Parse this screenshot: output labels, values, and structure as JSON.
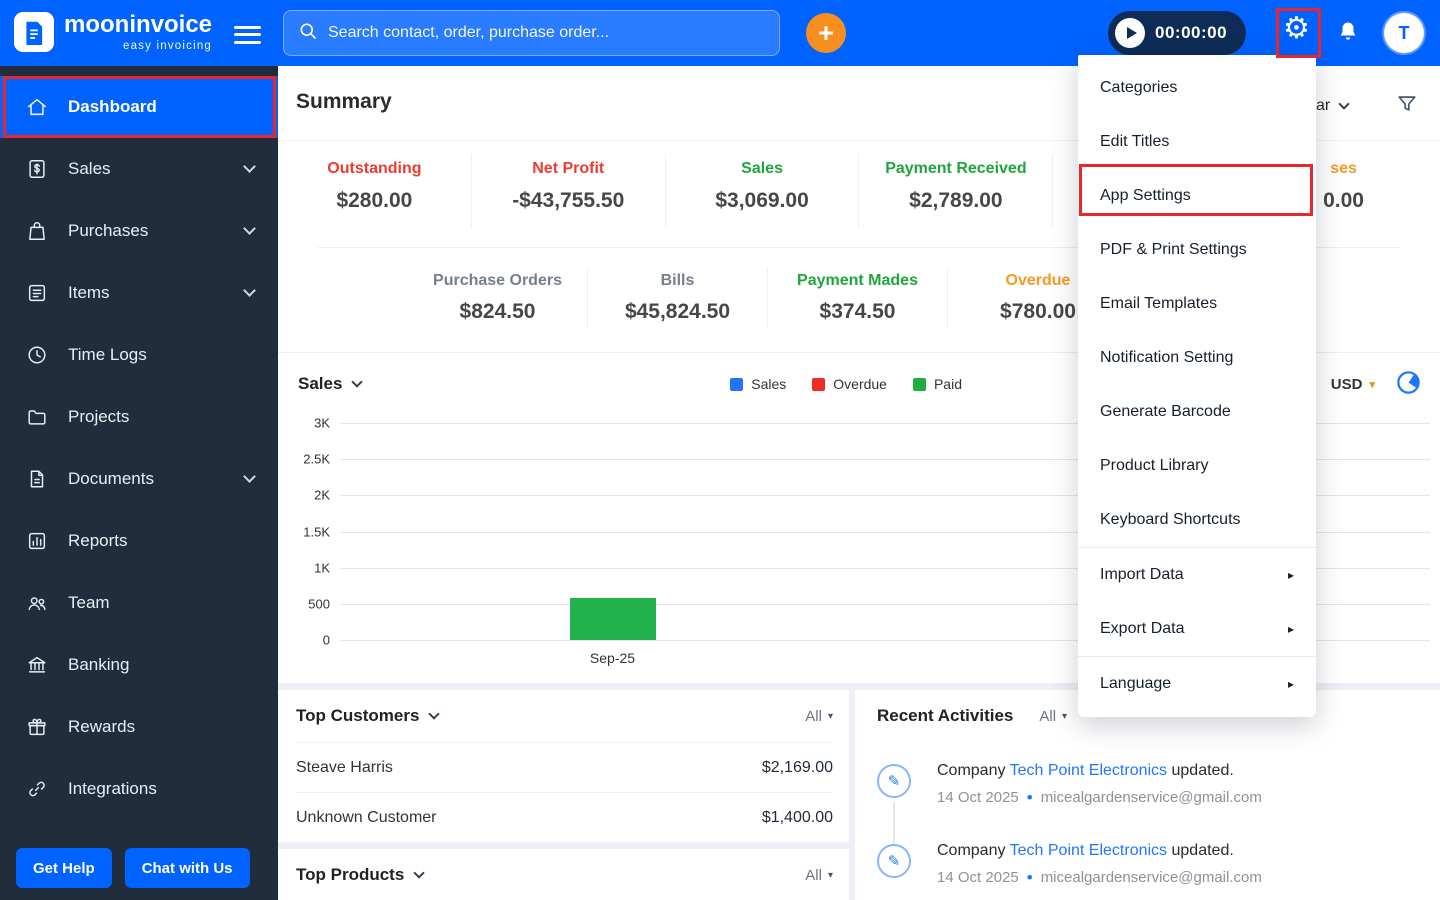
{
  "colors": {
    "topbar_blue": "#0062ff",
    "sidebar_navy": "#1f2d3d",
    "annotation_red": "#e8262b",
    "stat_red": "#ef3b2f",
    "stat_green": "#1ea63c",
    "stat_orange": "#f59a23",
    "link_blue": "#2176ff",
    "bar_green": "#21b24b",
    "plus_orange": "#f78f1e"
  },
  "topbar": {
    "brand": "mooninvoice",
    "tagline": "easy invoicing",
    "search_placeholder": "Search contact, order, purchase order...",
    "timer": "00:00:00",
    "avatar_initial": "T"
  },
  "sidebar": {
    "items": [
      {
        "label": "Dashboard"
      },
      {
        "label": "Sales"
      },
      {
        "label": "Purchases"
      },
      {
        "label": "Items"
      },
      {
        "label": "Time Logs"
      },
      {
        "label": "Projects"
      },
      {
        "label": "Documents"
      },
      {
        "label": "Reports"
      },
      {
        "label": "Team"
      },
      {
        "label": "Banking"
      },
      {
        "label": "Rewards"
      },
      {
        "label": "Integrations"
      }
    ],
    "get_help": "Get Help",
    "chat_with_us": "Chat with Us"
  },
  "summary": {
    "title": "Summary",
    "year_fragment": "ar",
    "row1": [
      {
        "label": "Outstanding",
        "value": "$280.00"
      },
      {
        "label": "Net Profit",
        "value": "-$43,755.50"
      },
      {
        "label": "Sales",
        "value": "$3,069.00"
      },
      {
        "label": "Payment Received",
        "value": "$2,789.00"
      },
      {
        "label": "",
        "value": ""
      },
      {
        "label": "ses",
        "value": "0.00"
      }
    ],
    "row2": [
      {
        "label": "Purchase Orders",
        "value": "$824.50"
      },
      {
        "label": "Bills",
        "value": "$45,824.50"
      },
      {
        "label": "Payment Mades",
        "value": "$374.50"
      },
      {
        "label": "Overdue",
        "value": "$780.00"
      }
    ]
  },
  "chart_data": {
    "type": "bar",
    "title": "Sales",
    "legend": [
      "Sales",
      "Overdue",
      "Paid"
    ],
    "currency": "USD",
    "yticks": [
      "3K",
      "2.5K",
      "2K",
      "1.5K",
      "1K",
      "500",
      "0"
    ],
    "ylim": [
      0,
      3000
    ],
    "categories": [
      "Sep-25"
    ],
    "series": [
      {
        "name": "Paid",
        "values": [
          580
        ]
      }
    ],
    "grid": true,
    "legend_position": "top-center"
  },
  "top_customers": {
    "title": "Top Customers",
    "filter": "All",
    "rows": [
      {
        "name": "Steave Harris",
        "value": "$2,169.00"
      },
      {
        "name": "Unknown Customer",
        "value": "$1,400.00"
      }
    ]
  },
  "top_products": {
    "title": "Top Products",
    "filter": "All"
  },
  "recent_activities": {
    "title": "Recent Activities",
    "filter": "All",
    "entries": [
      {
        "prefix": "Company",
        "link": "Tech Point Electronics",
        "suffix": "updated.",
        "date": "14 Oct 2025",
        "email": "micealgardenservice@gmail.com"
      },
      {
        "prefix": "Company",
        "link": "Tech Point Electronics",
        "suffix": "updated.",
        "date": "14 Oct 2025",
        "email": "micealgardenservice@gmail.com"
      }
    ]
  },
  "settings_menu": {
    "items": [
      {
        "label": "Categories"
      },
      {
        "label": "Edit Titles"
      },
      {
        "label": "App Settings"
      },
      {
        "label": "PDF & Print Settings"
      },
      {
        "label": "Email Templates"
      },
      {
        "label": "Notification Setting"
      },
      {
        "label": "Generate Barcode"
      },
      {
        "label": "Product Library"
      },
      {
        "label": "Keyboard Shortcuts"
      },
      {
        "label": "Import Data",
        "submenu": true
      },
      {
        "label": "Export Data",
        "submenu": true
      },
      {
        "label": "Language",
        "submenu": true
      }
    ]
  }
}
